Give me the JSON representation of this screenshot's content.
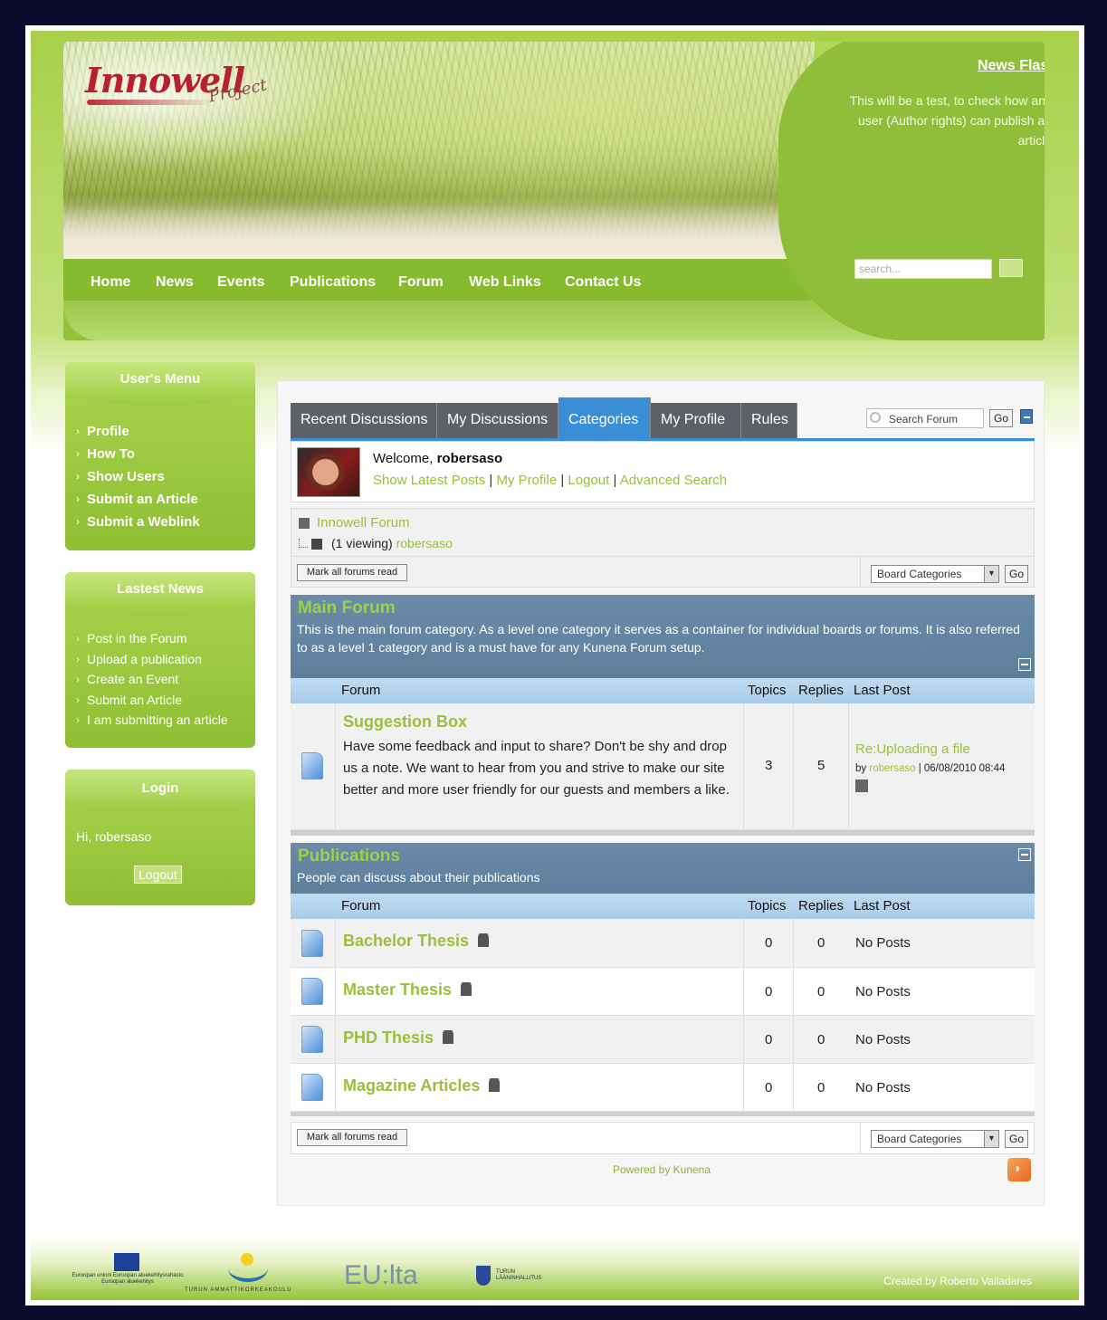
{
  "header": {
    "logo_text": "Innowell",
    "logo_sub": "Project",
    "news_flash_title": "News Flash",
    "news_flash_text": "This will be a test, to check how any user (Author rights) can publish an article",
    "search_placeholder": "search..."
  },
  "nav": [
    "Home",
    "News",
    "Events",
    "Publications",
    "Forum",
    "Web Links",
    "Contact Us"
  ],
  "sidebar": {
    "users_menu": {
      "title": "User's Menu",
      "items": [
        "Profile",
        "How To",
        "Show Users",
        "Submit an Article",
        "Submit a Weblink"
      ]
    },
    "latest_news": {
      "title": "Lastest News",
      "items": [
        "Post in the Forum",
        "Upload a publication",
        "Create an Event",
        "Submit an Article",
        "I am submitting an article"
      ]
    },
    "login": {
      "title": "Login",
      "greeting": "Hi, robersaso",
      "logout": "Logout"
    }
  },
  "forum": {
    "tabs": [
      "Recent Discussions",
      "My Discussions",
      "Categories",
      "My Profile",
      "Rules"
    ],
    "active_tab": "Categories",
    "search_placeholder": "Search Forum",
    "go": "Go",
    "welcome_label": "Welcome,",
    "username": "robersaso",
    "user_links": [
      "Show Latest Posts",
      "My Profile",
      "Logout",
      "Advanced Search"
    ],
    "breadcrumb_title": "Innowell Forum",
    "viewing_text": "(1 viewing)",
    "viewing_user": "robersaso",
    "mark_read": "Mark all forums read",
    "board_select": "Board Categories",
    "columns": [
      "Forum",
      "Topics",
      "Replies",
      "Last Post"
    ],
    "categories": [
      {
        "name": "Main Forum",
        "description": "This is the main forum category. As a level one category it serves as a container for individual boards or forums. It is also referred to as a level 1 category and is a must have for any Kunena Forum setup.",
        "forums": [
          {
            "name": "Suggestion Box",
            "description": "Have some feedback and input to share? Don't be shy and drop us a note. We want to hear from you and strive to make our site better and more user friendly for our guests and members a like.",
            "topics": "3",
            "replies": "5",
            "last_post_title": "Re:Uploading a file",
            "last_post_by_label": "by",
            "last_post_user": "robersaso",
            "last_post_date": "| 06/08/2010 08:44"
          }
        ]
      },
      {
        "name": "Publications",
        "description": "People can discuss about their publications",
        "forums": [
          {
            "name": "Bachelor Thesis",
            "topics": "0",
            "replies": "0",
            "last_post": "No Posts"
          },
          {
            "name": "Master Thesis",
            "topics": "0",
            "replies": "0",
            "last_post": "No Posts"
          },
          {
            "name": "PHD Thesis",
            "topics": "0",
            "replies": "0",
            "last_post": "No Posts"
          },
          {
            "name": "Magazine Articles",
            "topics": "0",
            "replies": "0",
            "last_post": "No Posts"
          }
        ]
      }
    ],
    "powered_by": "Powered by Kunena"
  },
  "footer": {
    "eu_caption": "Euroopan unioni Euroopan aluekehitysrahasto Euroopan aluekehitys",
    "turku_caption": "TURUN AMMATTIKORKEAKOULU",
    "eulta": "EU:lta",
    "crest_caption": "TURUN LÄÄNINHALLITUS",
    "created_by": "Created by Roberto Valladares"
  },
  "colors": {
    "accent_green": "#9bbf3a",
    "nav_green": "#86ba2f",
    "tab_active_blue": "#3a8ed6",
    "category_bar": "#5c7f9c",
    "table_header": "#a8cbe8"
  },
  "icons": [
    "search-icon",
    "collapse-icon",
    "document-icon",
    "user-icon",
    "rss-icon",
    "jump-icon"
  ]
}
